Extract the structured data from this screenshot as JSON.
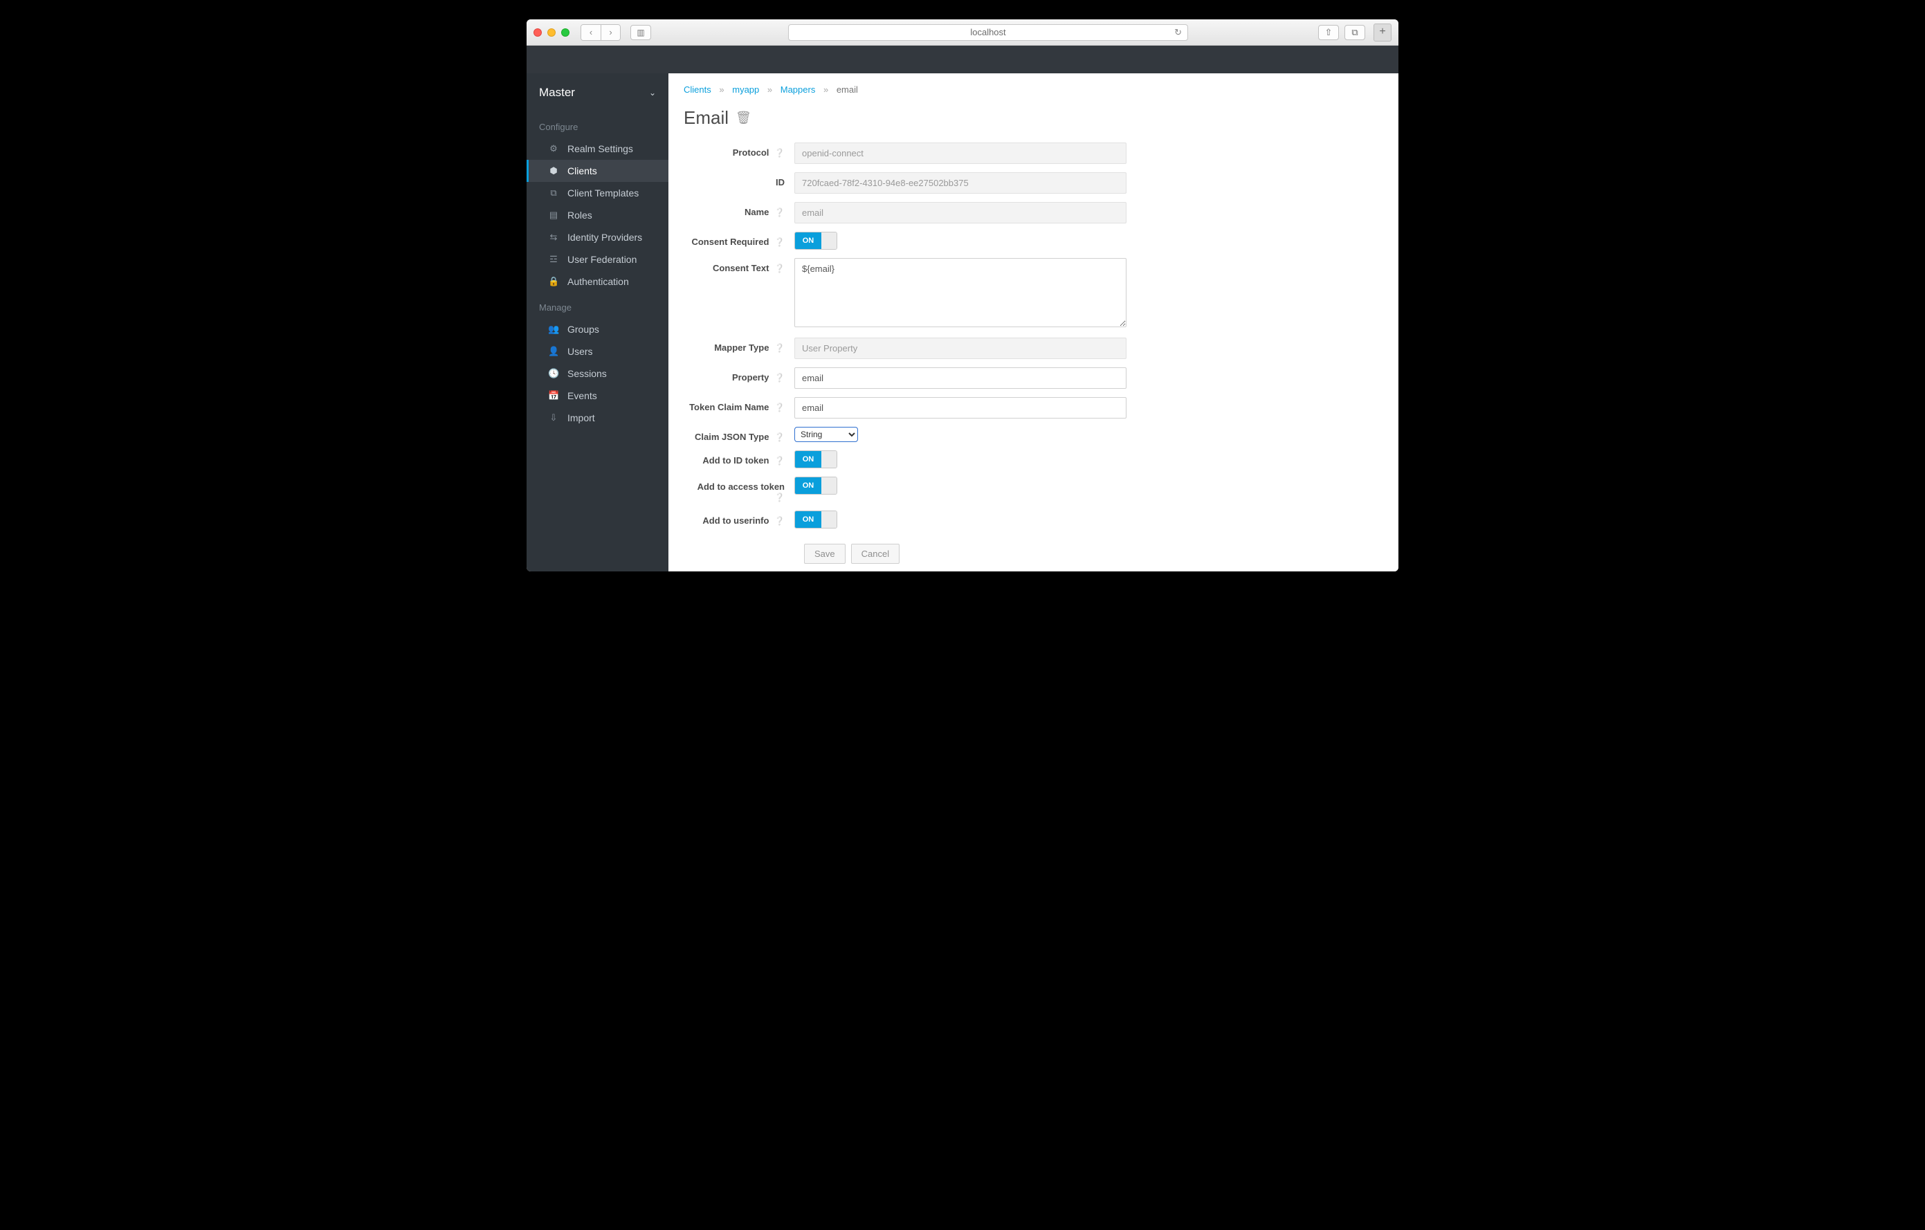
{
  "browser": {
    "url": "localhost"
  },
  "realm": {
    "name": "Master"
  },
  "sections": {
    "configure": "Configure",
    "manage": "Manage"
  },
  "nav": {
    "configure": [
      {
        "key": "realm-settings",
        "label": "Realm Settings"
      },
      {
        "key": "clients",
        "label": "Clients"
      },
      {
        "key": "client-templates",
        "label": "Client Templates"
      },
      {
        "key": "roles",
        "label": "Roles"
      },
      {
        "key": "identity-providers",
        "label": "Identity Providers"
      },
      {
        "key": "user-federation",
        "label": "User Federation"
      },
      {
        "key": "authentication",
        "label": "Authentication"
      }
    ],
    "manage": [
      {
        "key": "groups",
        "label": "Groups"
      },
      {
        "key": "users",
        "label": "Users"
      },
      {
        "key": "sessions",
        "label": "Sessions"
      },
      {
        "key": "events",
        "label": "Events"
      },
      {
        "key": "import",
        "label": "Import"
      }
    ]
  },
  "breadcrumb": {
    "clients": "Clients",
    "client": "myapp",
    "mappers": "Mappers",
    "current": "email"
  },
  "page": {
    "title": "Email"
  },
  "labels": {
    "protocol": "Protocol",
    "id": "ID",
    "name": "Name",
    "consent_required": "Consent Required",
    "consent_text": "Consent Text",
    "mapper_type": "Mapper Type",
    "property": "Property",
    "token_claim_name": "Token Claim Name",
    "claim_json_type": "Claim JSON Type",
    "add_to_id_token": "Add to ID token",
    "add_to_access_token": "Add to access token",
    "add_to_userinfo": "Add to userinfo"
  },
  "values": {
    "protocol": "openid-connect",
    "id": "720fcaed-78f2-4310-94e8-ee27502bb375",
    "name": "email",
    "consent_required": "ON",
    "consent_text": "${email}",
    "mapper_type": "User Property",
    "property": "email",
    "token_claim_name": "email",
    "claim_json_type": "String",
    "add_to_id_token": "ON",
    "add_to_access_token": "ON",
    "add_to_userinfo": "ON"
  },
  "buttons": {
    "save": "Save",
    "cancel": "Cancel"
  }
}
